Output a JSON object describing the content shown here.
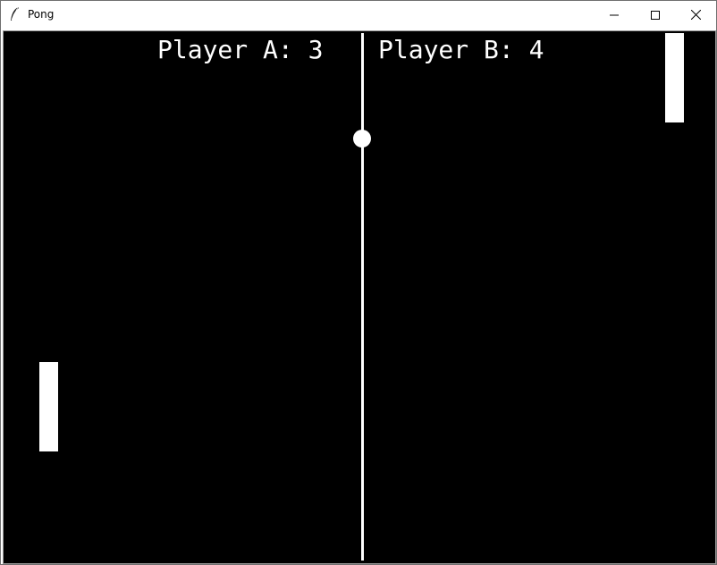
{
  "window": {
    "title": "Pong",
    "icon": "feather-icon",
    "controls": {
      "minimize_icon": "minimize-icon",
      "maximize_icon": "maximize-icon",
      "close_icon": "close-icon"
    }
  },
  "game": {
    "background_color": "#000000",
    "foreground_color": "#ffffff",
    "score_a_label": "Player A: 3",
    "score_b_label": "Player B: 4",
    "player_a": {
      "name": "Player A",
      "score": 3
    },
    "player_b": {
      "name": "Player B",
      "score": 4
    }
  }
}
